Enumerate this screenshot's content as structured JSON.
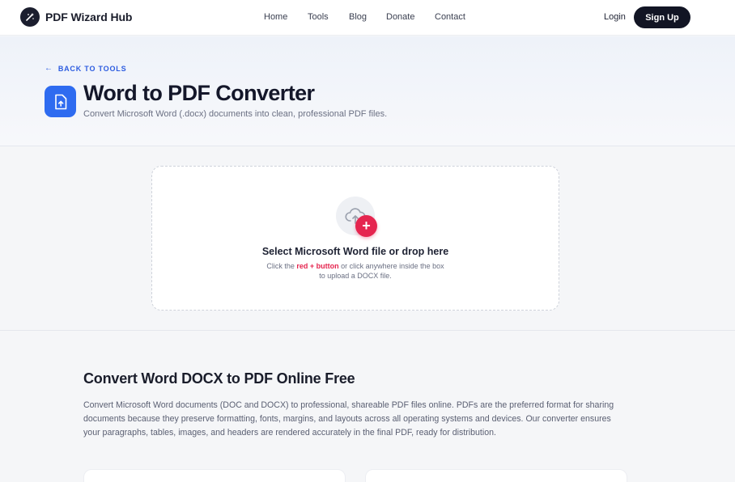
{
  "nav": {
    "brand": "PDF Wizard Hub",
    "links": [
      "Home",
      "Tools",
      "Blog",
      "Donate",
      "Contact"
    ],
    "login": "Login",
    "signup": "Sign Up"
  },
  "hero": {
    "back_label": "BACK TO TOOLS",
    "title": "Word to PDF Converter",
    "subtitle": "Convert Microsoft Word (.docx) documents into clean, professional PDF files.",
    "icon": "file-upload-icon"
  },
  "upload": {
    "title": "Select Microsoft Word file or drop here",
    "hint_prefix": "Click the ",
    "hint_highlight": "red + button",
    "hint_suffix": " or click anywhere inside the box",
    "hint_line2": "to upload a DOCX file.",
    "plus_symbol": "+",
    "icon": "cloud-upload-icon"
  },
  "content": {
    "title": "Convert Word DOCX to PDF Online Free",
    "body": "Convert Microsoft Word documents (DOC and DOCX) to professional, shareable PDF files online. PDFs are the preferred format for sharing documents because they preserve formatting, fonts, margins, and layouts across all operating systems and devices. Our converter ensures your paragraphs, tables, images, and headers are rendered accurately in the final PDF, ready for distribution."
  },
  "colors": {
    "accent_blue": "#2e6bf0",
    "accent_red": "#e5254f",
    "dark": "#121524"
  }
}
